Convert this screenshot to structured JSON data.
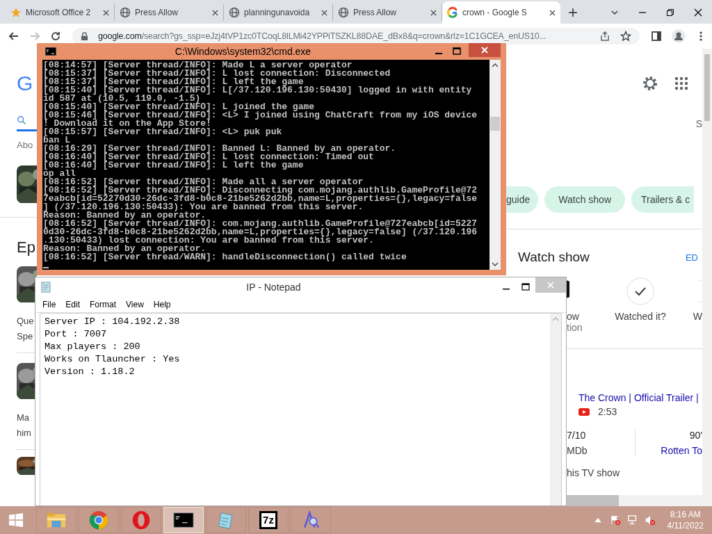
{
  "browser": {
    "tabs": [
      {
        "kind": "star",
        "title": "Microsoft Office 2",
        "selected": false
      },
      {
        "kind": "globe",
        "title": "Press Allow",
        "selected": false
      },
      {
        "kind": "globe",
        "title": "planningunavoida",
        "selected": false
      },
      {
        "kind": "globe",
        "title": "Press Allow",
        "selected": false
      },
      {
        "kind": "google",
        "title": "crown - Google S",
        "selected": true
      }
    ],
    "new_tab": "+",
    "url_host": "google.com",
    "url_rest": "/search?gs_ssp=eJzj4tVP1zc0TCoqL8lLMi42YPPiTSZKL88DAE_dBx8&q=crown&rlz=1C1GCEA_enUS10...",
    "page": {
      "logo": "G",
      "about": "Abo",
      "episodes_heading": "Ep",
      "episodes": [
        {
          "lines": [
            "Que",
            "Spe"
          ]
        },
        {
          "lines": [
            "Ma",
            "him"
          ]
        }
      ],
      "side_letter": "S",
      "chips": [
        "guide",
        "Watch show",
        "Trailers & c"
      ],
      "watch_heading": "Watch show",
      "edit": "ED",
      "actions": [
        {
          "kind": "partial-left",
          "label": "ow",
          "sub": "tion"
        },
        {
          "kind": "check",
          "label": "Watched it?"
        },
        {
          "kind": "partial-right",
          "label": "W"
        }
      ],
      "video": {
        "title": "The Crown | Official Trailer |",
        "duration": "2:53"
      },
      "ratings": [
        {
          "score": "7/10",
          "source": "MDb"
        },
        {
          "score": "90'",
          "source": "Rotten To"
        }
      ],
      "footer": "his TV show"
    }
  },
  "cmd": {
    "title": "C:\\Windows\\system32\\cmd.exe",
    "lines": [
      "[08:14:57] [Server thread/INFO]: Made L a server operator",
      "[08:15:37] [Server thread/INFO]: L lost connection: Disconnected",
      "[08:15:37] [Server thread/INFO]: L left the game",
      "[08:15:40] [Server thread/INFO]: L[/37.120.196.130:50430] logged in with entity",
      "id 587 at (10.5, 119.0, -1.5)",
      "[08:15:40] [Server thread/INFO]: L joined the game",
      "[08:15:46] [Server thread/INFO]: <L> I joined using ChatCraft from my iOS device",
      "! Download it on the App Store!",
      "[08:15:57] [Server thread/INFO]: <L> puk puk",
      "ban L",
      "[08:16:29] [Server thread/INFO]: Banned L: Banned by an operator.",
      "[08:16:40] [Server thread/INFO]: L lost connection: Timed out",
      "[08:16:40] [Server thread/INFO]: L left the game",
      "op all",
      "[08:16:52] [Server thread/INFO]: Made all a server operator",
      "[08:16:52] [Server thread/INFO]: Disconnecting com.mojang.authlib.GameProfile@72",
      "7eabcb[id=52270d30-26dc-3fd8-b0c8-21be5262d2bb,name=L,properties={},legacy=false",
      "] (/37.120.196.130:50433): You are banned from this server.",
      "Reason: Banned by an operator.",
      "[08:16:52] [Server thread/INFO]: com.mojang.authlib.GameProfile@727eabcb[id=5227",
      "0d30-26dc-3fd8-b0c8-21be5262d2bb,name=L,properties={},legacy=false] (/37.120.196",
      ".130:50433) lost connection: You are banned from this server.",
      "Reason: Banned by an operator.",
      "[08:16:52] [Server thread/WARN]: handleDisconnection() called twice"
    ]
  },
  "notepad": {
    "title": "IP - Notepad",
    "menu": [
      "File",
      "Edit",
      "Format",
      "View",
      "Help"
    ],
    "lines": [
      "Server IP : 104.192.2.38",
      "Port : 7007",
      "Max players : 200",
      "Works on Tlauncher : Yes",
      "Version : 1.18.2"
    ]
  },
  "taskbar": {
    "apps": [
      {
        "kind": "explorer",
        "selected": false
      },
      {
        "kind": "chrome",
        "selected": false
      },
      {
        "kind": "opera",
        "selected": false
      },
      {
        "kind": "cmd",
        "selected": true
      },
      {
        "kind": "notepad",
        "selected": false
      },
      {
        "kind": "archiver",
        "label": "7z",
        "selected": false
      },
      {
        "kind": "magnifier",
        "selected": false
      }
    ],
    "time": "8:16 AM",
    "date": "4/11/2022"
  }
}
